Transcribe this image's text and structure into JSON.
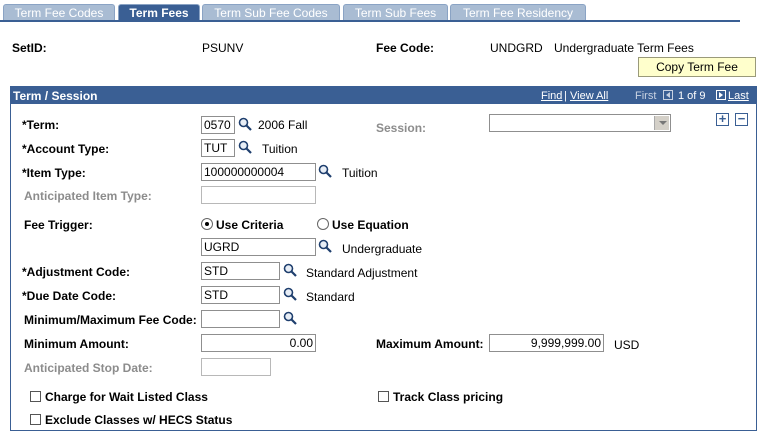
{
  "tabs": [
    {
      "label": "Term Fee Codes",
      "active": false
    },
    {
      "label": "Term Fees",
      "active": true
    },
    {
      "label": "Term Sub Fee Codes",
      "active": false
    },
    {
      "label": "Term Sub Fees",
      "active": false
    },
    {
      "label": "Term Fee Residency",
      "active": false
    }
  ],
  "header": {
    "setid_label": "SetID:",
    "setid_value": "PSUNV",
    "feecode_label": "Fee Code:",
    "feecode_value": "UNDGRD",
    "feecode_desc": "Undergraduate Term Fees",
    "copy_button": "Copy Term Fee"
  },
  "panel": {
    "title": "Term / Session",
    "nav": {
      "find": "Find",
      "sep": "|",
      "view_all": "View All",
      "first": "First",
      "position": "1 of 9",
      "last": "Last"
    },
    "add_symbol": "+",
    "remove_symbol": "−"
  },
  "form": {
    "term": {
      "label": "*Term:",
      "value": "0570",
      "desc": "2006 Fall"
    },
    "session": {
      "label": "Session:",
      "value": ""
    },
    "account_type": {
      "label": "*Account Type:",
      "value": "TUT",
      "desc": "Tuition"
    },
    "item_type": {
      "label": "*Item Type:",
      "value": "100000000004",
      "desc": "Tuition"
    },
    "anticipated_item_type": {
      "label": "Anticipated Item Type:",
      "value": ""
    },
    "fee_trigger": {
      "label": "Fee Trigger:",
      "option1": "Use Criteria",
      "option2": "Use Equation",
      "selected": "Use Criteria",
      "criteria_value": "UGRD",
      "criteria_desc": "Undergraduate"
    },
    "adjustment_code": {
      "label": "*Adjustment Code:",
      "value": "STD",
      "desc": "Standard Adjustment"
    },
    "due_date_code": {
      "label": "*Due Date Code:",
      "value": "STD",
      "desc": "Standard"
    },
    "minmax_fee_code": {
      "label": "Minimum/Maximum Fee Code:",
      "value": ""
    },
    "minimum_amount": {
      "label": "Minimum Amount:",
      "value": "0.00"
    },
    "maximum_amount": {
      "label": "Maximum Amount:",
      "value": "9,999,999.00",
      "currency": "USD"
    },
    "anticipated_stop_date": {
      "label": "Anticipated Stop Date:",
      "value": ""
    },
    "charge_wait_listed": {
      "label": "Charge for Wait Listed Class",
      "checked": false
    },
    "track_class_pricing": {
      "label": "Track Class pricing",
      "checked": false
    },
    "exclude_hecs": {
      "label": "Exclude Classes w/ HECS Status",
      "checked": false
    }
  }
}
